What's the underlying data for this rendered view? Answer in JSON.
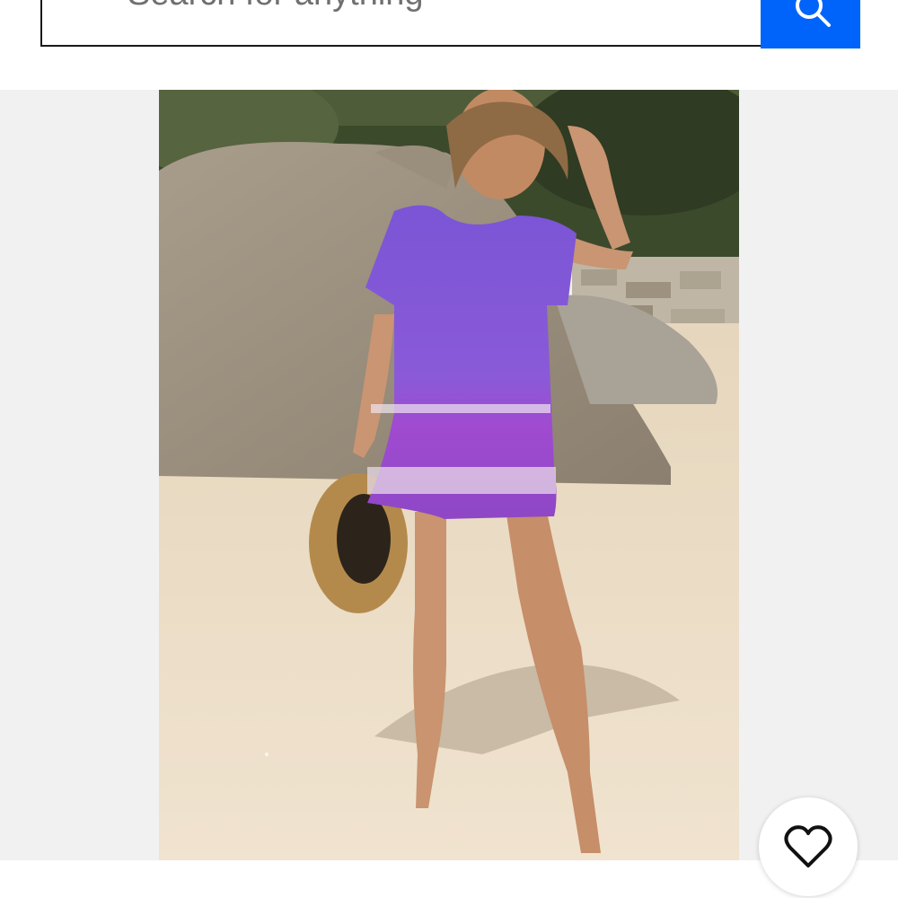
{
  "search": {
    "placeholder": "Search for anything"
  },
  "listing": {
    "image_alt": "Woman on a beach in a purple floral romper holding a straw hat"
  },
  "colors": {
    "search_button": "#0064fa",
    "gallery_background": "#f1f1f1"
  },
  "icons": {
    "search": "search-icon",
    "watch": "heart-icon"
  }
}
